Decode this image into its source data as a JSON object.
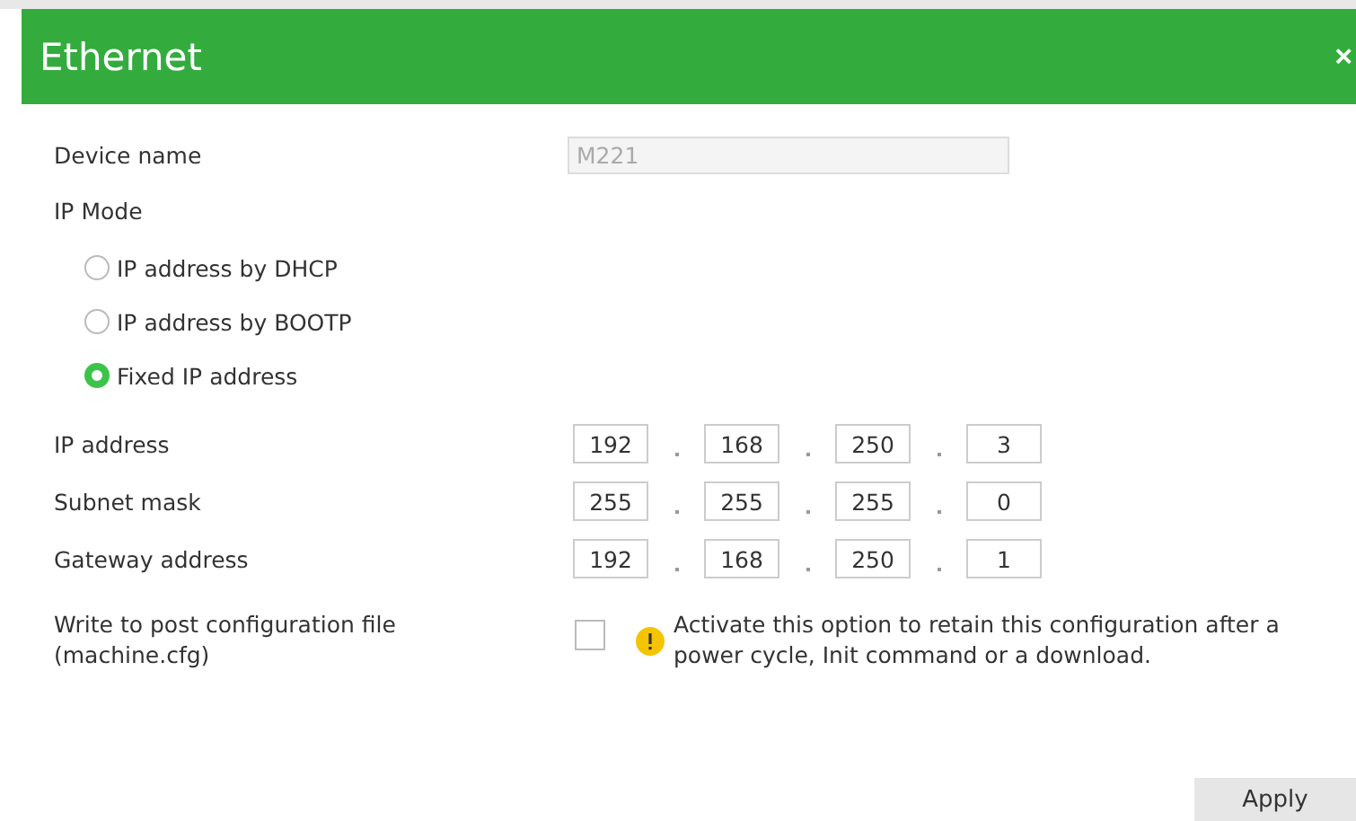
{
  "window": {
    "title": "Ethernet",
    "close": "×"
  },
  "device_name": {
    "label": "Device name",
    "value": "M221",
    "disabled": true
  },
  "ip_mode": {
    "label": "IP Mode",
    "options": [
      {
        "label": "IP address by DHCP",
        "selected": false
      },
      {
        "label": "IP address by BOOTP",
        "selected": false
      },
      {
        "label": "Fixed IP address",
        "selected": true
      }
    ]
  },
  "addresses": [
    {
      "label": "IP address",
      "octets": [
        "192",
        "168",
        "250",
        "3"
      ]
    },
    {
      "label": "Subnet mask",
      "octets": [
        "255",
        "255",
        "255",
        "0"
      ]
    },
    {
      "label": "Gateway address",
      "octets": [
        "192",
        "168",
        "250",
        "1"
      ]
    }
  ],
  "post_config": {
    "label": "Write to post configuration file (machine.cfg)",
    "checked": false,
    "note": "Activate this option to retain this configuration after a power cycle, Init command or a download."
  },
  "buttons": [
    "Apply"
  ]
}
